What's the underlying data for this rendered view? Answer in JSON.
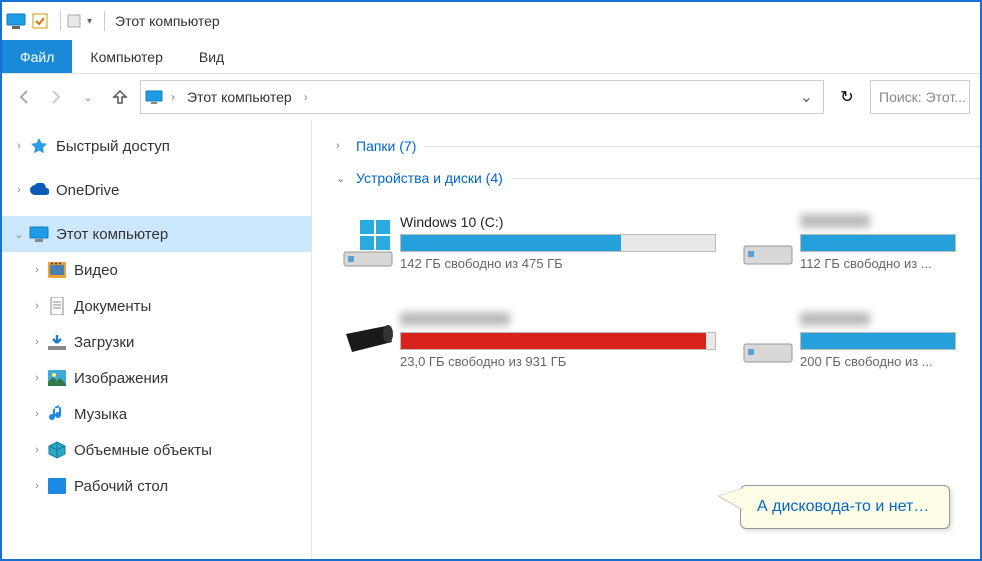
{
  "window": {
    "title": "Этот компьютер"
  },
  "menu": {
    "file": "Файл",
    "computer": "Компьютер",
    "view": "Вид"
  },
  "nav": {
    "breadcrumb": "Этот компьютер",
    "search_placeholder": "Поиск: Этот..."
  },
  "sidebar": {
    "items": [
      {
        "label": "Быстрый доступ",
        "icon": "star",
        "expandable": true
      },
      {
        "label": "OneDrive",
        "icon": "cloud",
        "expandable": true
      },
      {
        "label": "Этот компьютер",
        "icon": "pc",
        "expandable": true,
        "selected": true,
        "expanded": true
      },
      {
        "label": "Видео",
        "icon": "video",
        "expandable": true,
        "child": true
      },
      {
        "label": "Документы",
        "icon": "doc",
        "expandable": true,
        "child": true
      },
      {
        "label": "Загрузки",
        "icon": "down",
        "expandable": true,
        "child": true
      },
      {
        "label": "Изображения",
        "icon": "img",
        "expandable": true,
        "child": true
      },
      {
        "label": "Музыка",
        "icon": "music",
        "expandable": true,
        "child": true
      },
      {
        "label": "Объемные объекты",
        "icon": "cube",
        "expandable": true,
        "child": true
      },
      {
        "label": "Рабочий стол",
        "icon": "desk",
        "expandable": true,
        "child": true
      }
    ]
  },
  "groups": {
    "folders": {
      "label": "Папки",
      "count": "(7)",
      "collapsed": true
    },
    "devices": {
      "label": "Устройства и диски",
      "count": "(4)",
      "collapsed": false
    }
  },
  "drives": [
    {
      "name": "Windows 10 (C:)",
      "status": "142 ГБ свободно из 475 ГБ",
      "fill_pct": 70,
      "color": "#26a0da",
      "icon": "os",
      "blur": false
    },
    {
      "name": "________",
      "status": "112 ГБ свободно из ...",
      "fill_pct": 100,
      "color": "#26a0da",
      "icon": "hdd",
      "blur": true
    },
    {
      "name": "____ ___",
      "status": "23,0 ГБ свободно из 931 ГБ",
      "fill_pct": 97,
      "color": "#d9221c",
      "icon": "ext",
      "blur": true
    },
    {
      "name": "____ __",
      "status": "200 ГБ свободно из ...",
      "fill_pct": 100,
      "color": "#26a0da",
      "icon": "hdd",
      "blur": true
    }
  ],
  "callout": {
    "text": "А дисковода-то и нет…"
  }
}
